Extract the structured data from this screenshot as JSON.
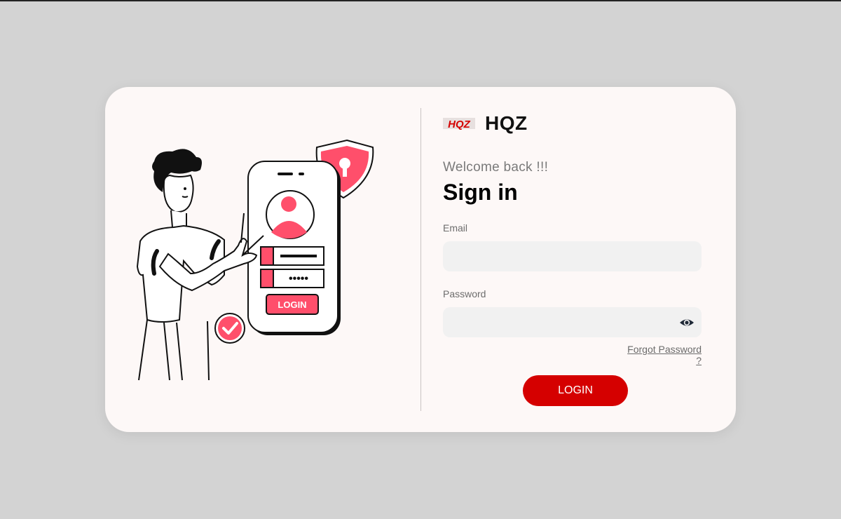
{
  "brand": {
    "logo_text": "HQZ",
    "name": "HQZ"
  },
  "form": {
    "welcome": "Welcome back !!!",
    "title": "Sign in",
    "email_label": "Email",
    "email_value": "",
    "password_label": "Password",
    "password_value": "",
    "forgot_link": "Forgot Password ?",
    "login_button": "LOGIN"
  },
  "illustration": {
    "phone_button_text": "LOGIN",
    "password_dots": "•••••"
  },
  "colors": {
    "background": "#d3d3d3",
    "card": "#fdf8f7",
    "accent": "#d50000",
    "illustration_pink": "#ff4f6b"
  },
  "icons": [
    "hqz-logo-icon",
    "eye-icon",
    "shield-lock-icon",
    "user-avatar-icon",
    "checkmark-icon"
  ]
}
